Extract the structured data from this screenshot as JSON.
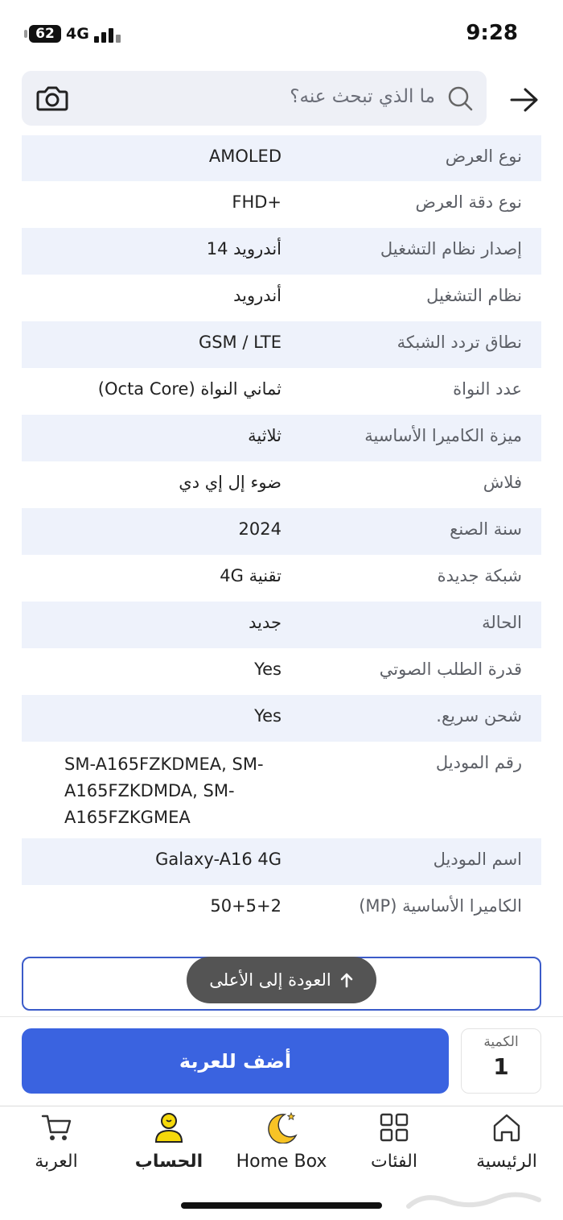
{
  "status_bar": {
    "battery": "62",
    "network": "4G",
    "time": "9:28"
  },
  "search": {
    "placeholder": "ما الذي تبحث عنه؟"
  },
  "specs": [
    {
      "label": "نوع العرض",
      "value": "AMOLED"
    },
    {
      "label": "نوع دقة العرض",
      "value": "FHD+"
    },
    {
      "label": "إصدار نظام التشغيل",
      "value": "أندرويد 14"
    },
    {
      "label": "نظام التشغيل",
      "value": "أندرويد"
    },
    {
      "label": "نطاق تردد الشبكة",
      "value": "GSM / LTE"
    },
    {
      "label": "عدد النواة",
      "value": "ثماني النواة (Octa Core)"
    },
    {
      "label": "ميزة الكاميرا الأساسية",
      "value": "ثلاثية"
    },
    {
      "label": "فلاش",
      "value": "ضوء إل إي دي"
    },
    {
      "label": "سنة الصنع",
      "value": "2024"
    },
    {
      "label": "شبكة جديدة",
      "value": "تقنية 4G"
    },
    {
      "label": "الحالة",
      "value": "جديد"
    },
    {
      "label": "قدرة الطلب الصوتي",
      "value": "Yes"
    },
    {
      "label": "شحن سريع.",
      "value": "Yes"
    },
    {
      "label": "رقم الموديل",
      "value": "SM-A165FZKDMEA, SM-A165FZKDMDA, SM-A165FZKGMEA"
    },
    {
      "label": "اسم الموديل",
      "value": "Galaxy-A16 4G"
    },
    {
      "label": "الكاميرا الأساسية (MP)",
      "value": "50+5+2"
    }
  ],
  "back_to_top": {
    "label": "العودة إلى الأعلى",
    "icon": "arrow-up-icon"
  },
  "cart": {
    "add_label": "أضف للعربة",
    "quantity_label": "الكمية",
    "quantity_value": "1",
    "accent": "#3a63e0"
  },
  "nav": {
    "home": {
      "label": "الرئيسية",
      "icon": "home-icon"
    },
    "categories": {
      "label": "الفئات",
      "icon": "grid-icon"
    },
    "homebox": {
      "label": "Home Box",
      "icon": "crescent-icon"
    },
    "account": {
      "label": "الحساب",
      "icon": "user-icon"
    },
    "cart": {
      "label": "العربة",
      "icon": "cart-icon"
    }
  }
}
